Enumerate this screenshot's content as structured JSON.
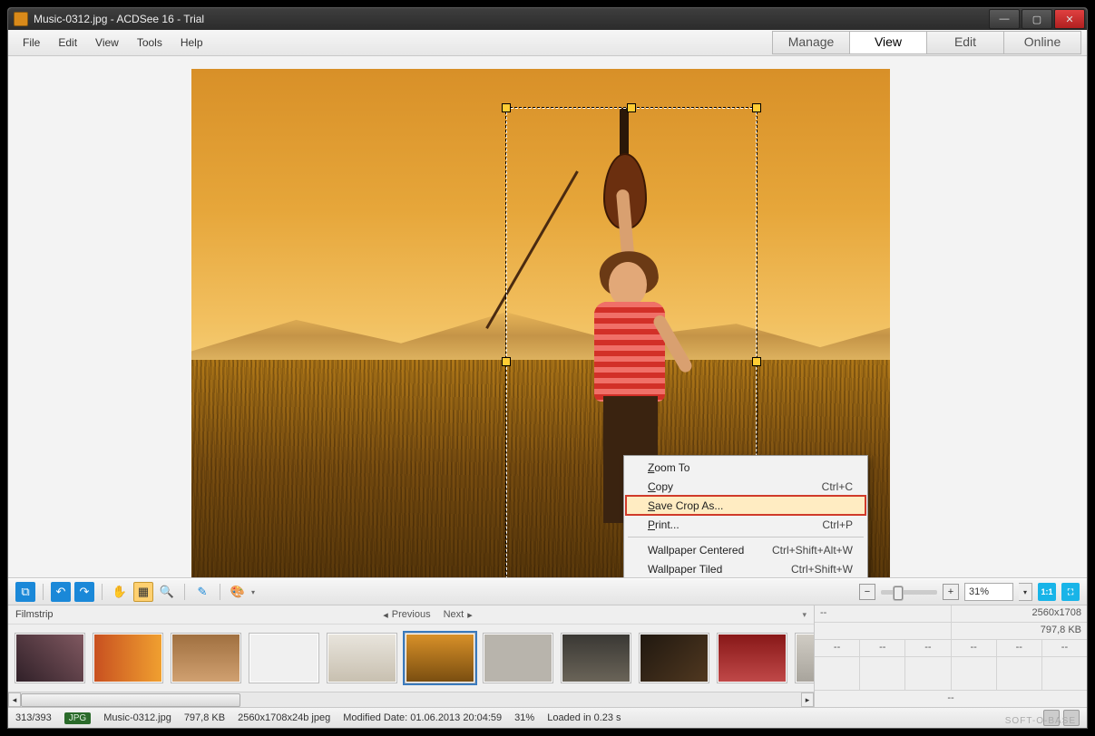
{
  "title": "Music-0312.jpg - ACDSee 16 - Trial",
  "menu": [
    "File",
    "Edit",
    "View",
    "Tools",
    "Help"
  ],
  "modes": {
    "items": [
      "Manage",
      "View",
      "Edit",
      "Online"
    ],
    "active": "View"
  },
  "context_menu": {
    "items": [
      {
        "label": "Zoom To",
        "u": 0,
        "shortcut": ""
      },
      {
        "label": "Copy",
        "u": 0,
        "shortcut": "Ctrl+C"
      },
      {
        "label": "Save Crop As...",
        "u": 0,
        "shortcut": "",
        "highlight": true
      },
      {
        "label": "Print...",
        "u": 0,
        "shortcut": "Ctrl+P"
      },
      {
        "sep": true
      },
      {
        "label": "Wallpaper Centered",
        "u": -1,
        "shortcut": "Ctrl+Shift+Alt+W"
      },
      {
        "label": "Wallpaper Tiled",
        "u": -1,
        "shortcut": "Ctrl+Shift+W"
      }
    ]
  },
  "zoom": {
    "value": "31%"
  },
  "filmstrip": {
    "label": "Filmstrip",
    "prev": "Previous",
    "next": "Next"
  },
  "info": {
    "topL": "--",
    "topR": "2560x1708",
    "sizeR": "797,8 KB",
    "dash": "--"
  },
  "status": {
    "count": "313/393",
    "format": "JPG",
    "name": "Music-0312.jpg",
    "size": "797,8 KB",
    "dims": "2560x1708x24b jpeg",
    "modlabel": "Modified Date:",
    "modval": "01.06.2013 20:04:59",
    "zoom": "31%",
    "loaded": "Loaded in 0.23 s",
    "watermark": "SOFT-O-BASE"
  }
}
